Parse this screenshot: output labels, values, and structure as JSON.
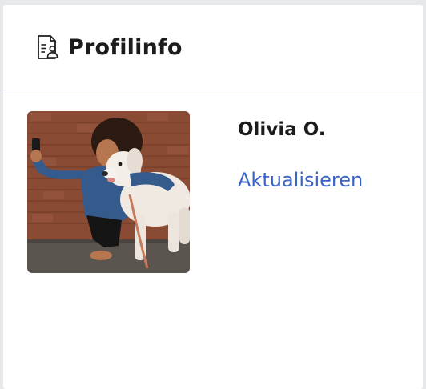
{
  "card": {
    "title": "Profilinfo",
    "title_icon": "profile-document-icon"
  },
  "profile": {
    "name": "Olivia O.",
    "update_link": "Aktualisieren",
    "photo_description_icon": "profile-photo"
  },
  "colors": {
    "link": "#3b64c7",
    "text": "#1c1c1c",
    "divider": "#c9d0d9",
    "background": "#e6e8eb"
  }
}
